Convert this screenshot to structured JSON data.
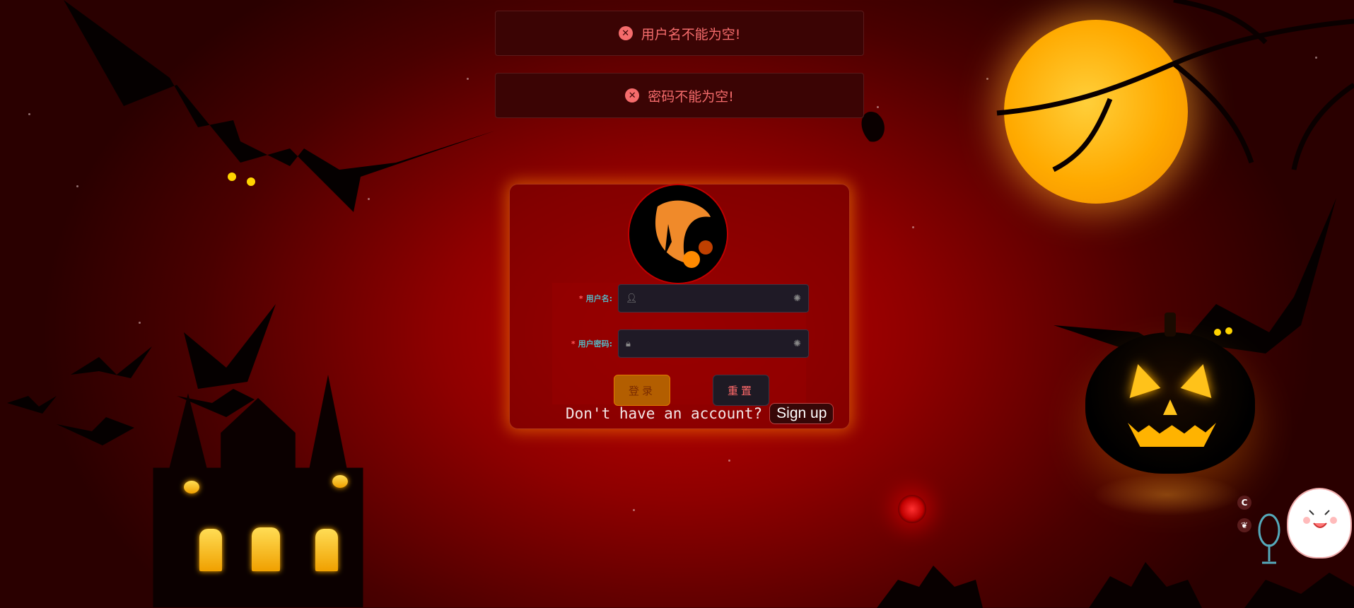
{
  "alerts": [
    {
      "icon": "error-circle-icon",
      "message": "用户名不能为空!"
    },
    {
      "icon": "error-circle-icon",
      "message": "密码不能为空!"
    }
  ],
  "login_form": {
    "username_label": "用户名:",
    "username_value": "",
    "password_label": "用户密码:",
    "password_value": "",
    "required_mark": "*",
    "login_button": "登录",
    "reset_button": "重置"
  },
  "signup": {
    "prompt": "Don't have an account?",
    "button": "Sign up"
  },
  "side_widget": {
    "btn1": "C",
    "btn2": "❦"
  },
  "colors": {
    "accent_error": "#f56c6c",
    "label": "#56b6c2",
    "login_button": "#b35e00"
  }
}
